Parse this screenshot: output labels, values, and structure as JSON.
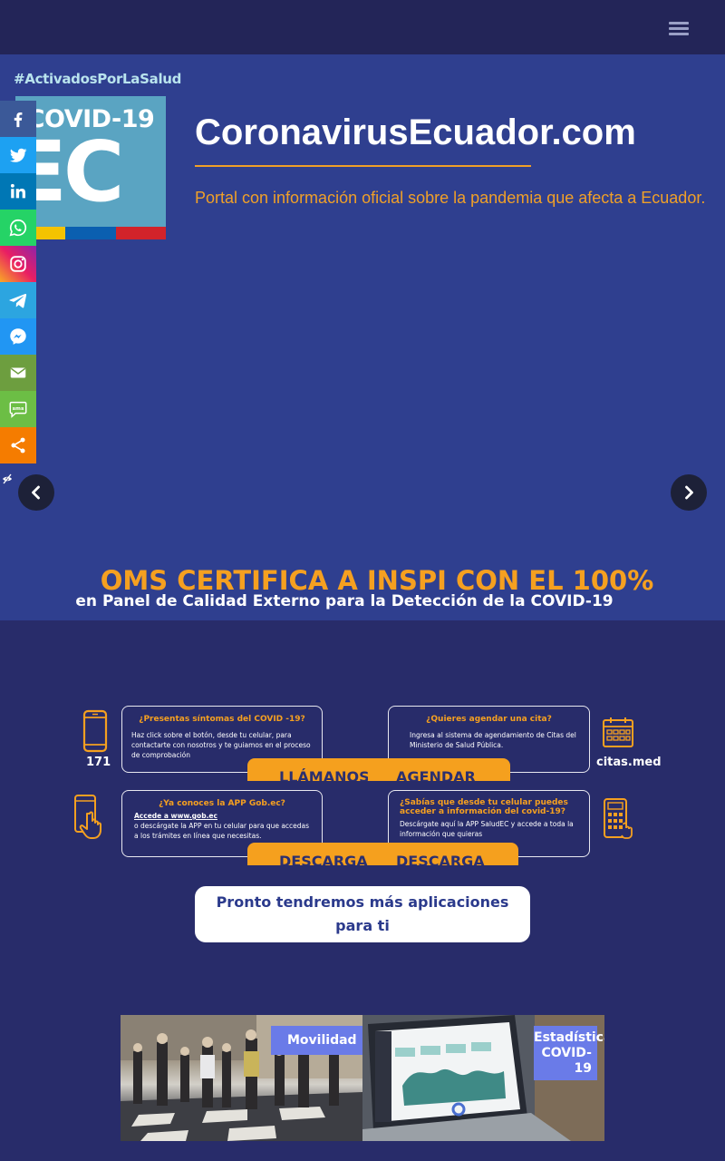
{
  "header": {
    "menu_icon": "hamburger-menu-icon"
  },
  "hero": {
    "hashtag": "#ActivadosPorLaSalud",
    "logo_line1": "COVID-19",
    "logo_line2": "EC",
    "flag_colors": [
      "#f4c300",
      "#0b5fb0",
      "#d2232a"
    ],
    "site_title": "CoronavirusEcuador.com",
    "site_description": "Portal con información oficial sobre la pandemia que afecta a Ecuador.",
    "headline": "OMS CERTIFICA A INSPI CON EL 100%",
    "subheadline": "en Panel de Calidad Externo para la Detección de la COVID-19"
  },
  "social": [
    {
      "name": "facebook",
      "icon": "facebook-icon",
      "color": "#3b5998"
    },
    {
      "name": "twitter",
      "icon": "twitter-icon",
      "color": "#1da1f2"
    },
    {
      "name": "linkedin",
      "icon": "linkedin-icon",
      "color": "#0077b5"
    },
    {
      "name": "whatsapp",
      "icon": "whatsapp-icon",
      "color": "#25d366"
    },
    {
      "name": "instagram",
      "icon": "instagram-icon",
      "color": "#c13584"
    },
    {
      "name": "telegram",
      "icon": "telegram-icon",
      "color": "#2ca5e0"
    },
    {
      "name": "messenger",
      "icon": "messenger-icon",
      "color": "#2196f3"
    },
    {
      "name": "email",
      "icon": "email-icon",
      "color": "#6d9e3f"
    },
    {
      "name": "sms",
      "icon": "sms-icon",
      "color": "#6cbe45"
    },
    {
      "name": "share",
      "icon": "share-icon",
      "color": "#f57c00"
    }
  ],
  "services": {
    "call": {
      "question": "¿Presentas síntomas del COVID -19?",
      "text": "Haz click sobre el botón, desde tu celular, para contactarte con nosotros y te guiamos en el proceso de comprobación",
      "number": "171",
      "button": "LLÁMANOS"
    },
    "appointment": {
      "question": "¿Quieres agendar una cita?",
      "text": "Ingresa al sistema de agendamiento de Citas del Ministerio de Salud Pública.",
      "label": "citas.med",
      "button": "AGENDAR"
    },
    "gobec": {
      "question": "¿Ya conoces la APP Gob.ec?",
      "link": "Accede a www.gob.ec",
      "text": "o descárgate la APP en tu celular para que accedas a los trámites en línea que necesitas.",
      "button": "DESCARGA"
    },
    "saludec": {
      "question": "¿Sabías que desde tu celular puedes acceder a información del covid-19?",
      "text": "Descárgate aquí la APP SaludEC y accede a toda la información que quieras",
      "button": "DESCARGA"
    }
  },
  "soon_text": "Pronto tendremos más aplicaciones para ti",
  "banners": {
    "left_label": "Movilidad",
    "right_label_line1": "Estadísticas",
    "right_label_line2": "COVID-19"
  },
  "colors": {
    "accent": "#f5a020",
    "navy": "#282c6a",
    "hero": "#2f3f8f"
  }
}
